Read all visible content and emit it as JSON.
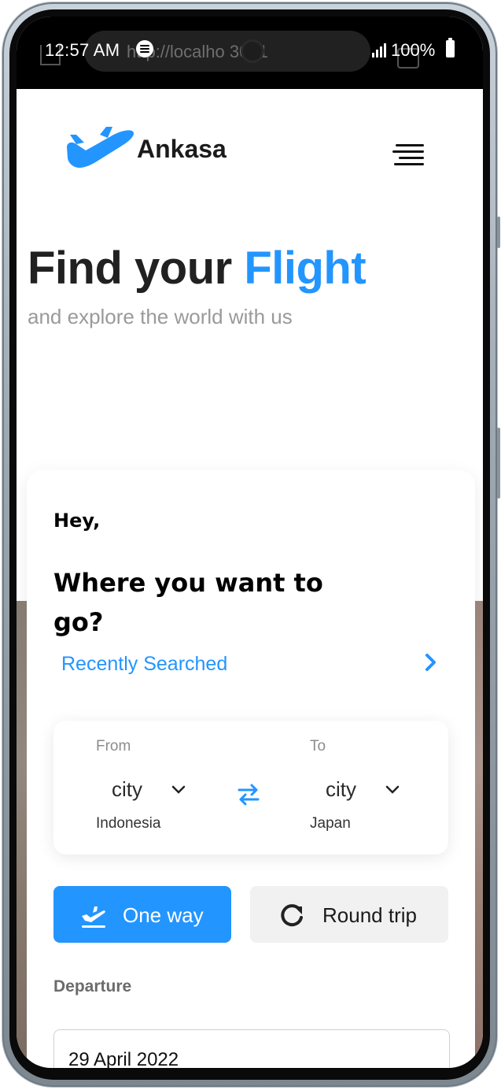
{
  "status_bar": {
    "time": "12:57 AM",
    "url": "http://localho  3001",
    "battery": "100%"
  },
  "header": {
    "brand": "Ankasa",
    "brand_color": "#2395ff",
    "menu_icon": "hamburger-icon"
  },
  "hero": {
    "title_prefix": "Find your ",
    "title_accent": "Flight",
    "subtitle": "and explore the world with us"
  },
  "search_card": {
    "greeting": "Hey,",
    "question": "Where you want to go?",
    "recently_searched": "Recently Searched",
    "from": {
      "label": "From",
      "city": "city",
      "country": "Indonesia"
    },
    "to": {
      "label": "To",
      "city": "city",
      "country": "Japan"
    },
    "trip_types": {
      "one_way": "One way",
      "round_trip": "Round trip",
      "selected": "one_way"
    },
    "departure_label": "Departure",
    "departure_value": "29 April 2022"
  }
}
